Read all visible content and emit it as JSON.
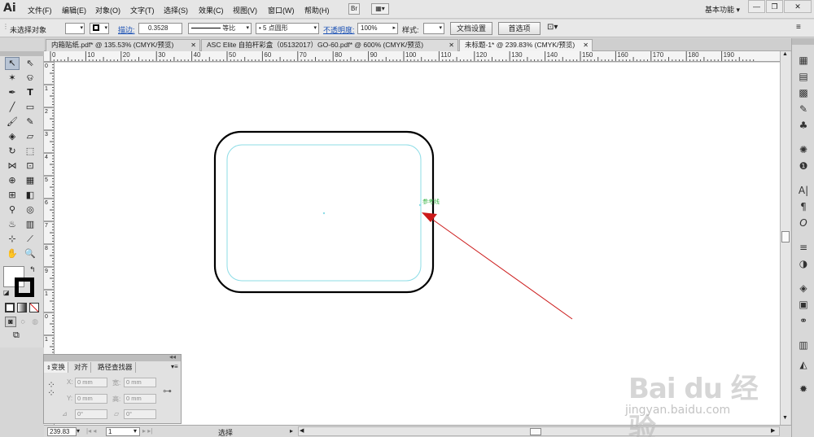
{
  "menubar": {
    "logo": "Ai",
    "items": [
      "文件(F)",
      "编辑(E)",
      "对象(O)",
      "文字(T)",
      "选择(S)",
      "效果(C)",
      "视图(V)",
      "窗口(W)",
      "帮助(H)"
    ],
    "bridge_label": "Br",
    "workspace": "基本功能",
    "workspace_arrow": "▾",
    "minimize": "—",
    "restore": "❐",
    "close": "✕"
  },
  "controlbar": {
    "selection_status": "未选择对象",
    "stroke_label": "描边:",
    "stroke_value": "0.3528",
    "stroke_profile": "等比",
    "brush_value": "5 点圆形",
    "brush_dot": "•",
    "opacity_label": "不透明度:",
    "opacity_value": "100%",
    "style_label": "样式:",
    "doc_setup_button": "文档设置",
    "preferences_button": "首选项"
  },
  "tabs": [
    {
      "label": "内箱贴纸.pdf* @ 135.53% (CMYK/预览)",
      "close": "✕"
    },
    {
      "label": "ASC Elite 自拍杆彩盒（05132017）GO-60.pdf* @ 600% (CMYK/预览)",
      "close": "✕"
    },
    {
      "label": "未标题-1* @ 239.83% (CMYK/预览)",
      "close": "✕"
    }
  ],
  "ruler_top": [
    "0",
    "10",
    "20",
    "30",
    "40",
    "50",
    "60",
    "70",
    "80",
    "90",
    "100",
    "110",
    "120",
    "130",
    "140",
    "150",
    "160",
    "170",
    "180",
    "190"
  ],
  "ruler_left": [
    "0",
    "1",
    "2",
    "3",
    "4",
    "5",
    "6",
    "7",
    "8",
    "9",
    "1",
    "0",
    "1",
    "1",
    "1",
    "2"
  ],
  "canvas": {
    "smart_guide_label": "参考线",
    "outer_stroke_color": "#000000",
    "inner_guide_color": "#8cdce6",
    "arrow_color": "#cc1a1a"
  },
  "transform_panel": {
    "tabs": [
      "变换",
      "对齐",
      "路径查找器"
    ],
    "x_label": "X:",
    "x_value": "0 mm",
    "y_label": "Y:",
    "y_value": "0 mm",
    "w_label": "宽:",
    "w_value": "0 mm",
    "h_label": "高:",
    "h_value": "0 mm",
    "angle_value": "0°",
    "shear_value": "0°"
  },
  "statusbar": {
    "zoom": "239.83",
    "artboard": "1",
    "tool": "选择"
  },
  "watermark": {
    "brand": "Bai du 经验",
    "url": "jingyan.baidu.com"
  }
}
